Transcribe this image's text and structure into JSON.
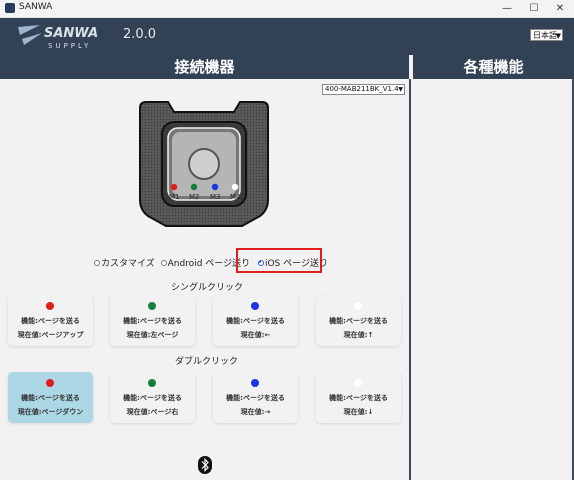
{
  "window": {
    "title": "SANWA"
  },
  "header": {
    "logo_text_top": "SANWA",
    "logo_text_bottom": "SUPPLY",
    "version": "2.0.0",
    "language": "日本語"
  },
  "sections": {
    "left_title": "接続機器",
    "right_title": "各種機能"
  },
  "model_select": "400-MAB211BK_V1.4",
  "device": {
    "buttons": [
      {
        "label": "M1",
        "color": "#e11d1d"
      },
      {
        "label": "M2",
        "color": "#15803d"
      },
      {
        "label": "M3",
        "color": "#1d33e6"
      },
      {
        "label": "M4",
        "color": "#ffffff"
      }
    ]
  },
  "modes": [
    {
      "label": "カスタマイズ",
      "selected": false
    },
    {
      "label": "Android ページ送り",
      "selected": false
    },
    {
      "label": "iOS ページ送り",
      "selected": true
    }
  ],
  "single_click": {
    "title": "シングルクリック",
    "cards": [
      {
        "color": "#e11d1d",
        "function": "機能:ページを送る",
        "value": "現在値:ページアップ"
      },
      {
        "color": "#15803d",
        "function": "機能:ページを送る",
        "value": "現在値:左ページ"
      },
      {
        "color": "#1d33e6",
        "function": "機能:ページを送る",
        "value": "現在値:←"
      },
      {
        "color": "#ffffff",
        "function": "機能:ページを送る",
        "value": "現在値:↑"
      }
    ]
  },
  "double_click": {
    "title": "ダブルクリック",
    "cards": [
      {
        "color": "#e11d1d",
        "function": "機能:ページを送る",
        "value": "現在値:ページダウン"
      },
      {
        "color": "#15803d",
        "function": "機能:ページを送る",
        "value": "現在値:ページ右"
      },
      {
        "color": "#1d33e6",
        "function": "機能:ページを送る",
        "value": "現在値:→"
      },
      {
        "color": "#ffffff",
        "function": "機能:ページを送る",
        "value": "現在値:↓"
      }
    ]
  },
  "icons": {
    "bluetooth": "bluetooth-icon",
    "minimize": "minimize-icon",
    "maximize": "maximize-icon",
    "close": "close-icon"
  }
}
